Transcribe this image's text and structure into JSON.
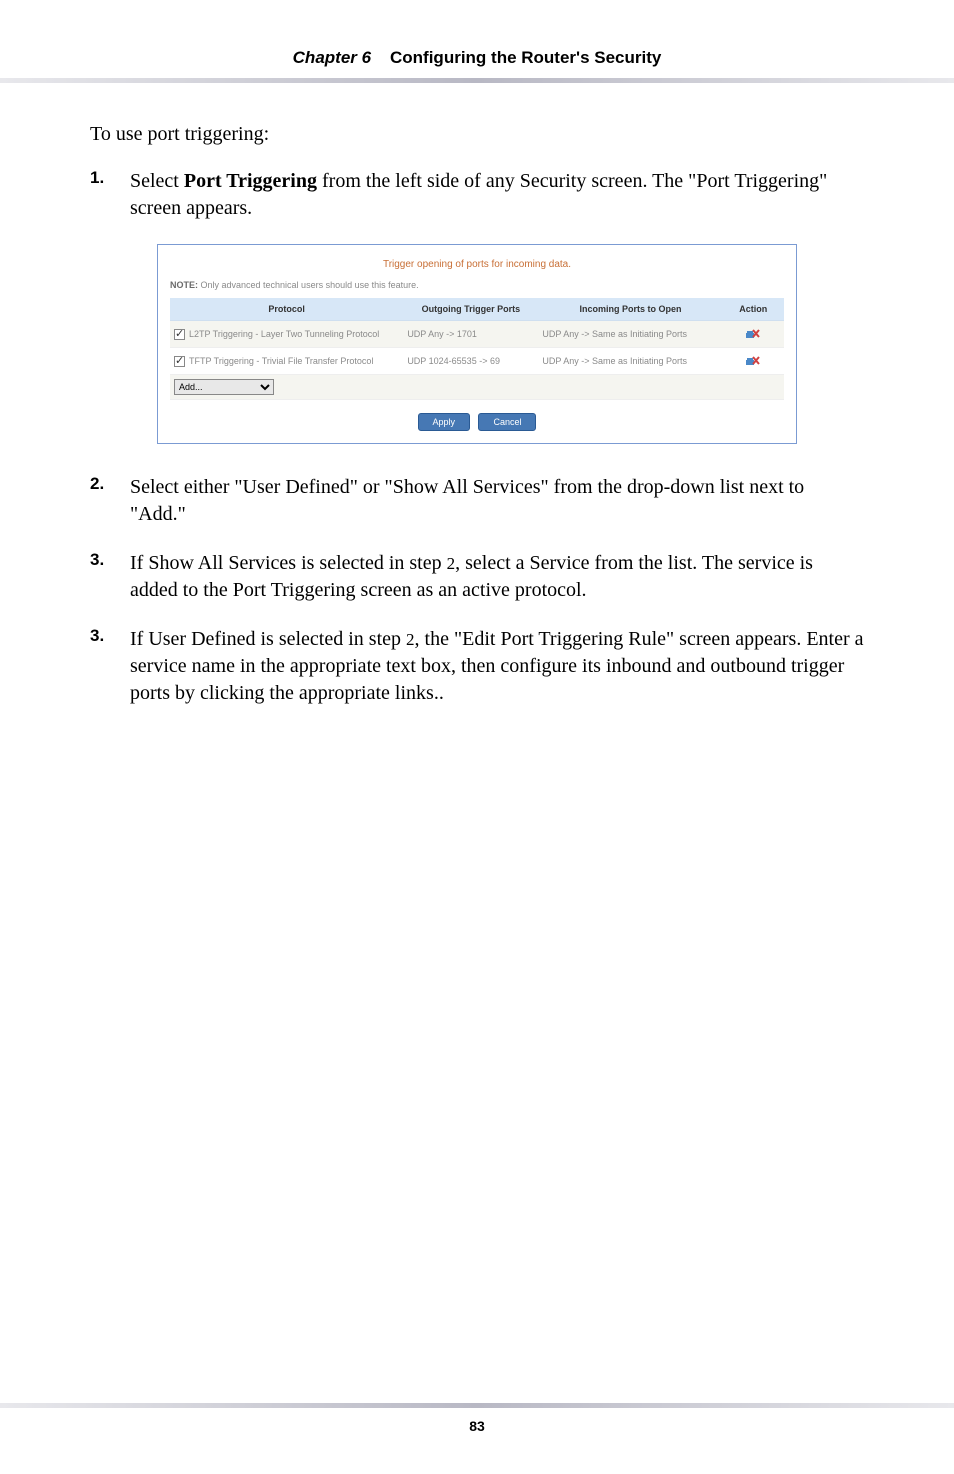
{
  "header": {
    "chapter": "Chapter 6",
    "title": "Configuring the Router's Security"
  },
  "intro": "To use port triggering:",
  "steps": [
    {
      "num": "1.",
      "parts": {
        "a": "Select ",
        "bold": "Port Triggering",
        "b": " from the left side of any Security screen. The \"Port Triggering\" screen appears."
      }
    },
    {
      "num": "2.",
      "text": "Select either \"User Defined\" or \"Show All Services\" from the drop-down list next to \"Add.\""
    },
    {
      "num": "3.",
      "text_a": "If Show All Services is selected in step ",
      "small": "2",
      "text_b": ", select a Service from the list. The service is added to the Port Triggering screen as an active protocol."
    },
    {
      "num": "3.",
      "text_a": "If  User Defined is selected in step ",
      "small": "2",
      "text_b": ", the \"Edit Port Triggering Rule\" screen appears. Enter a service name in the appropriate text box, then configure its inbound and outbound trigger ports by clicking the appropriate links.."
    }
  ],
  "figure": {
    "title": "Trigger opening of ports for incoming data.",
    "note_label": "NOTE:",
    "note_text": " Only advanced technical users should use this feature.",
    "headers": {
      "protocol": "Protocol",
      "outgoing": "Outgoing Trigger Ports",
      "incoming": "Incoming Ports to Open",
      "action": "Action"
    },
    "rows": [
      {
        "protocol": "L2TP Triggering - Layer Two Tunneling Protocol",
        "outgoing": "UDP Any -> 1701",
        "incoming": "UDP Any -> Same as Initiating Ports"
      },
      {
        "protocol": "TFTP Triggering - Trivial File Transfer Protocol",
        "outgoing": "UDP 1024-65535 -> 69",
        "incoming": "UDP Any -> Same as Initiating Ports"
      }
    ],
    "add_label": "Add...",
    "buttons": {
      "apply": "Apply",
      "cancel": "Cancel"
    }
  },
  "page_number": "83"
}
